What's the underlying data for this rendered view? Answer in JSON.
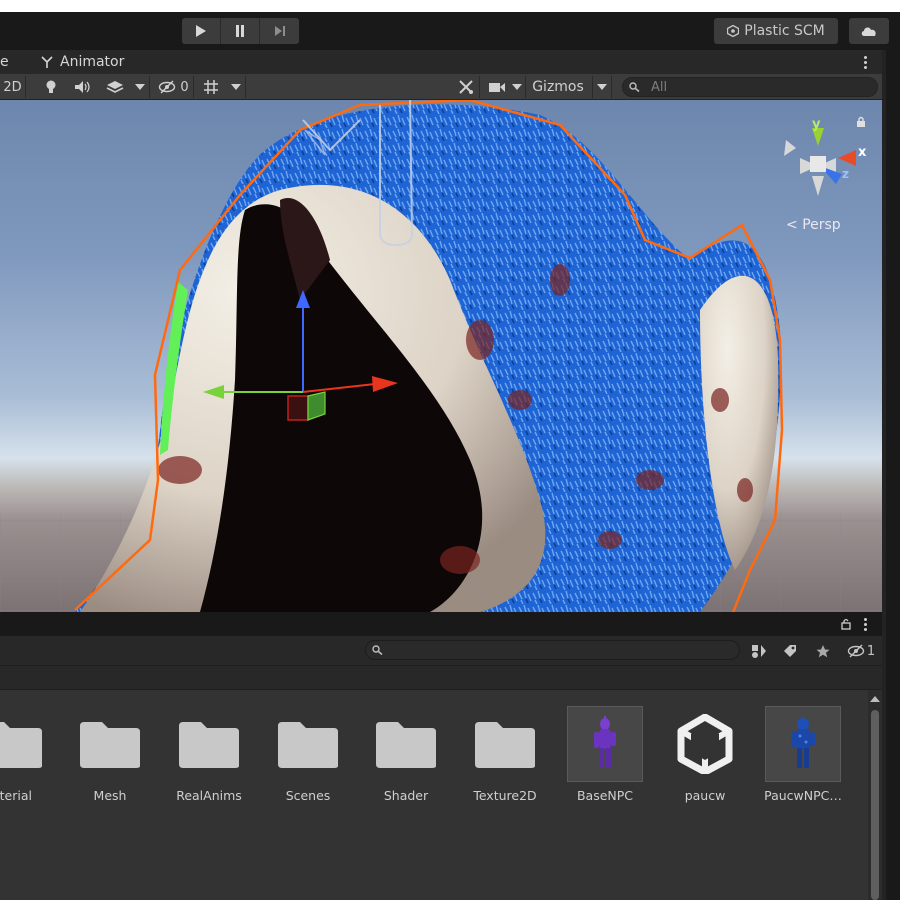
{
  "top_bar": {
    "play_icon": "play-icon",
    "pause_icon": "pause-icon",
    "step_icon": "step-icon",
    "plastic_label": "Plastic SCM",
    "cloud_icon": "cloud-icon"
  },
  "tabs": {
    "scene_partial": "e",
    "animator": "Animator"
  },
  "scene_toolbar": {
    "mode_2d": "2D",
    "hidden_count": "0",
    "gizmos_label": "Gizmos",
    "search_placeholder": "All"
  },
  "scene": {
    "persp_label": "Persp",
    "axis_y": "y",
    "axis_x": "x",
    "axis_z": "z"
  },
  "project": {
    "hidden_count": "1",
    "assets": [
      {
        "name": "aterial",
        "kind": "folder"
      },
      {
        "name": "Mesh",
        "kind": "folder"
      },
      {
        "name": "RealAnims",
        "kind": "folder"
      },
      {
        "name": "Scenes",
        "kind": "folder"
      },
      {
        "name": "Shader",
        "kind": "folder"
      },
      {
        "name": "Texture2D",
        "kind": "folder"
      },
      {
        "name": "BaseNPC",
        "kind": "prefab"
      },
      {
        "name": "paucw",
        "kind": "unity-model"
      },
      {
        "name": "PaucwNPC…",
        "kind": "prefab"
      }
    ]
  },
  "colors": {
    "accent_orange": "#ff6a10",
    "panel_bg": "#333333",
    "toolbar_bg": "#3c3c3c",
    "fur_blue": "#1f66d6"
  }
}
